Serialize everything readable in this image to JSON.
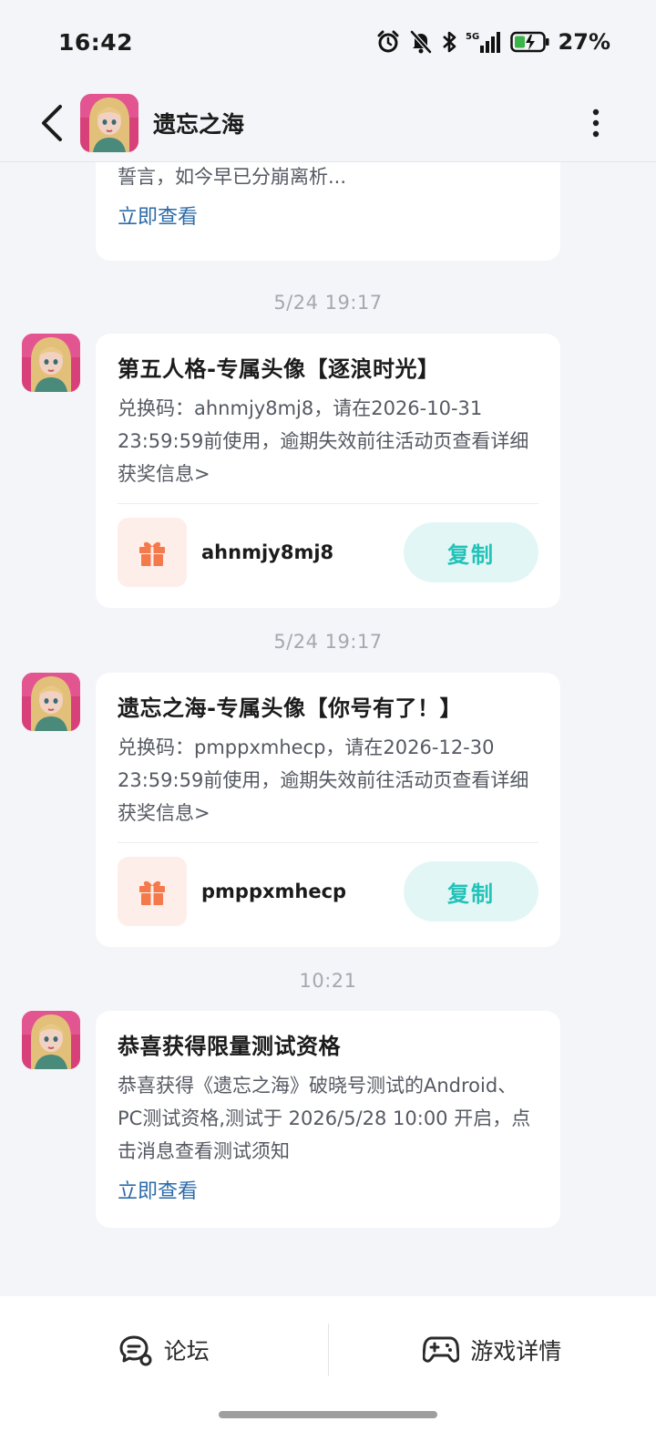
{
  "status_bar": {
    "time": "16:42",
    "network": "5G",
    "battery": "27%"
  },
  "header": {
    "title": "遗忘之海"
  },
  "messages": [
    {
      "partial": true,
      "body": "誓言，如今早已分崩离析...",
      "link": "立即查看"
    },
    {
      "time": "5/24  19:17",
      "title": "第五人格-专属头像【逐浪时光】",
      "body": "兑换码：ahnmjy8mj8，请在2026-10-31 23:59:59前使用，逾期失效前往活动页查看详细获奖信息>",
      "code": "ahnmjy8mj8",
      "copy_label": "复制"
    },
    {
      "time": "5/24  19:17",
      "title": "遗忘之海-专属头像【你号有了！】",
      "body": "兑换码：pmppxmhecp，请在2026-12-30 23:59:59前使用，逾期失效前往活动页查看详细获奖信息>",
      "code": "pmppxmhecp",
      "copy_label": "复制"
    },
    {
      "time": "10:21",
      "title": "恭喜获得限量测试资格",
      "body": "恭喜获得《遗忘之海》破晓号测试的Android、PC测试资格,测试于 2026/5/28 10:00 开启，点击消息查看测试须知",
      "link": "立即查看"
    }
  ],
  "bottom_bar": {
    "forum_label": "论坛",
    "game_details_label": "游戏详情"
  },
  "colors": {
    "accent": "#22c2b8",
    "link": "#2d6ba8",
    "gift": "#f47a4b",
    "background": "#f4f5f8"
  }
}
